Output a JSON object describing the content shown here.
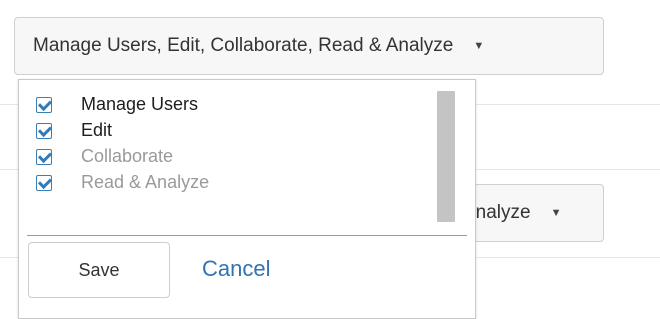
{
  "top_select": {
    "value": "Manage Users, Edit, Collaborate, Read & Analyze",
    "caret": "▼",
    "icon": "caret-down-icon"
  },
  "row2_select": {
    "visible_value": "Analyze",
    "caret": "▼",
    "icon": "caret-down-icon"
  },
  "dropdown": {
    "options": [
      {
        "label": "Manage Users",
        "checked": true,
        "enabled": true
      },
      {
        "label": "Edit",
        "checked": true,
        "enabled": true
      },
      {
        "label": "Collaborate",
        "checked": true,
        "enabled": false
      },
      {
        "label": "Read & Analyze",
        "checked": true,
        "enabled": false
      }
    ],
    "save_label": "Save",
    "cancel_label": "Cancel"
  },
  "colors": {
    "checkbox": "#2f7bbd",
    "cancel_link": "#3373b1",
    "disabled_text": "#9a9a9a"
  }
}
